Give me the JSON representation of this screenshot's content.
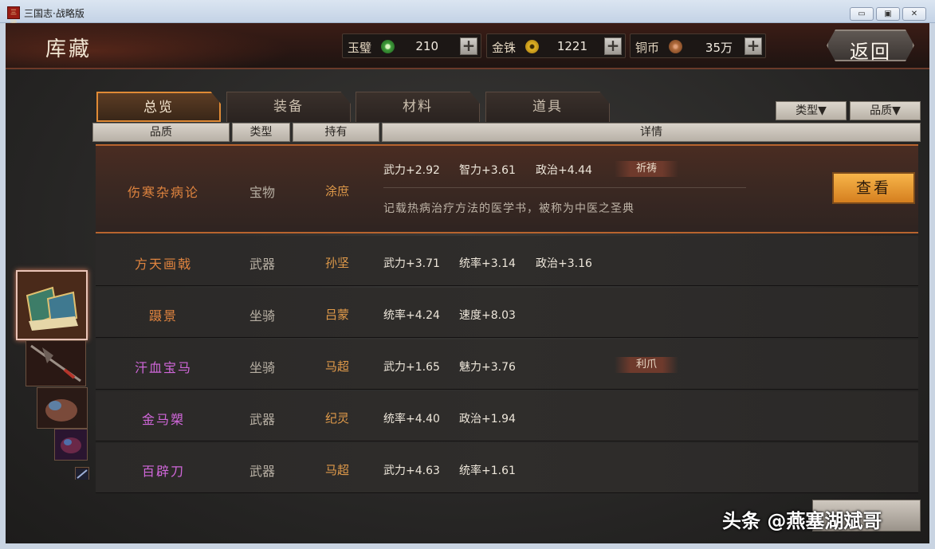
{
  "window": {
    "title": "三国志·战略版",
    "icon_text": "三國志",
    "controls": [
      "minimize",
      "maximize",
      "close"
    ]
  },
  "header": {
    "title": "库藏",
    "back_label": "返回",
    "resources": [
      {
        "name": "玉璧",
        "value": "210",
        "icon": "jade-disc-icon",
        "color": "#4caf50"
      },
      {
        "name": "金铢",
        "value": "1221",
        "icon": "gold-coin-icon",
        "color": "#d4a017"
      },
      {
        "name": "铜币",
        "value": "35万",
        "icon": "copper-coin-icon",
        "color": "#b06b3c"
      }
    ],
    "plus_label": "+"
  },
  "tabs": [
    {
      "label": "总览",
      "active": true
    },
    {
      "label": "装备",
      "active": false
    },
    {
      "label": "材料",
      "active": false
    },
    {
      "label": "道具",
      "active": false
    }
  ],
  "filters": {
    "type_label": "类型▼",
    "quality_label": "品质▼"
  },
  "table": {
    "headers": {
      "quality": "品质",
      "type": "类型",
      "owner": "持有",
      "details": "详情"
    },
    "rows": [
      {
        "name": "伤寒杂病论",
        "type": "宝物",
        "owner": "涂庶",
        "stats": [
          "武力+2.92",
          "智力+3.61",
          "政治+4.44"
        ],
        "tag": "祈祷",
        "desc": "记载热病治疗方法的医学书，被称为中医之圣典",
        "name_color": "#e0843f",
        "selected": true
      },
      {
        "name": "方天画戟",
        "type": "武器",
        "owner": "孙坚",
        "stats": [
          "武力+3.71",
          "统率+3.14",
          "政治+3.16"
        ],
        "tag": "",
        "name_color": "#e0843f"
      },
      {
        "name": "蹑景",
        "type": "坐骑",
        "owner": "吕蒙",
        "stats": [
          "统率+4.24",
          "速度+8.03"
        ],
        "tag": "",
        "name_color": "#e0843f"
      },
      {
        "name": "汗血宝马",
        "type": "坐骑",
        "owner": "马超",
        "stats": [
          "武力+1.65",
          "魅力+3.76"
        ],
        "tag": "利爪",
        "name_color": "#d067d9"
      },
      {
        "name": "金马槊",
        "type": "武器",
        "owner": "纪灵",
        "stats": [
          "统率+4.40",
          "政治+1.94"
        ],
        "tag": "",
        "name_color": "#d067d9"
      },
      {
        "name": "百辟刀",
        "type": "武器",
        "owner": "马超",
        "stats": [
          "武力+4.63",
          "统率+1.61"
        ],
        "tag": "",
        "name_color": "#d067d9"
      }
    ],
    "view_button": "查看"
  },
  "thumbnails": [
    "book-item-icon",
    "halberd-item-icon",
    "horse-item-icon",
    "horse-dark-item-icon",
    "blade-item-icon"
  ],
  "watermark": "头条 @燕塞湖斌哥"
}
